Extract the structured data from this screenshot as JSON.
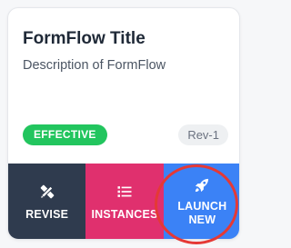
{
  "form": {
    "title": "FormFlow Title",
    "description": "Description of FormFlow",
    "status": "EFFECTIVE",
    "revision": "Rev-1"
  },
  "actions": {
    "revise": {
      "label": "REVISE",
      "icon": "pencil-ruler-icon",
      "color": "#2f3b4e"
    },
    "instances": {
      "label": "INSTANCES",
      "icon": "list-icon",
      "color": "#e0306e"
    },
    "launch": {
      "label_line1": "LAUNCH",
      "label_line2": "NEW",
      "icon": "rocket-icon",
      "color": "#3b82f6"
    }
  },
  "colors": {
    "status_badge": "#22c55e",
    "highlight_ring": "#e53935"
  }
}
